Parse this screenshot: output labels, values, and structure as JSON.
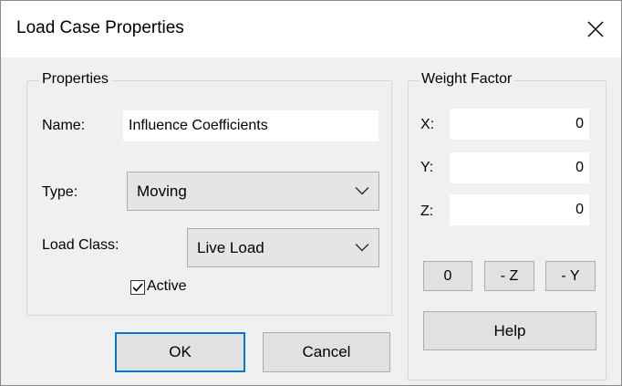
{
  "dialog": {
    "title": "Load Case Properties",
    "close_glyph": "✕"
  },
  "properties": {
    "group_label": "Properties",
    "name_label": "Name:",
    "name_value": "Influence Coefficients",
    "type_label": "Type:",
    "type_value": "Moving",
    "load_class_label": "Load Class:",
    "load_class_value": "Live Load",
    "active_label": "Active",
    "active_checked": true
  },
  "weight_factor": {
    "group_label": "Weight Factor",
    "x_label": "X:",
    "x_value": "0",
    "y_label": "Y:",
    "y_value": "0",
    "z_label": "Z:",
    "z_value": "0",
    "btn_zero": "0",
    "btn_minus_z": "- Z",
    "btn_minus_y": "- Y",
    "help_label": "Help"
  },
  "footer": {
    "ok_label": "OK",
    "cancel_label": "Cancel"
  },
  "colors": {
    "focus_border": "#0078d7",
    "dialog_bg": "#f0f0f0"
  }
}
